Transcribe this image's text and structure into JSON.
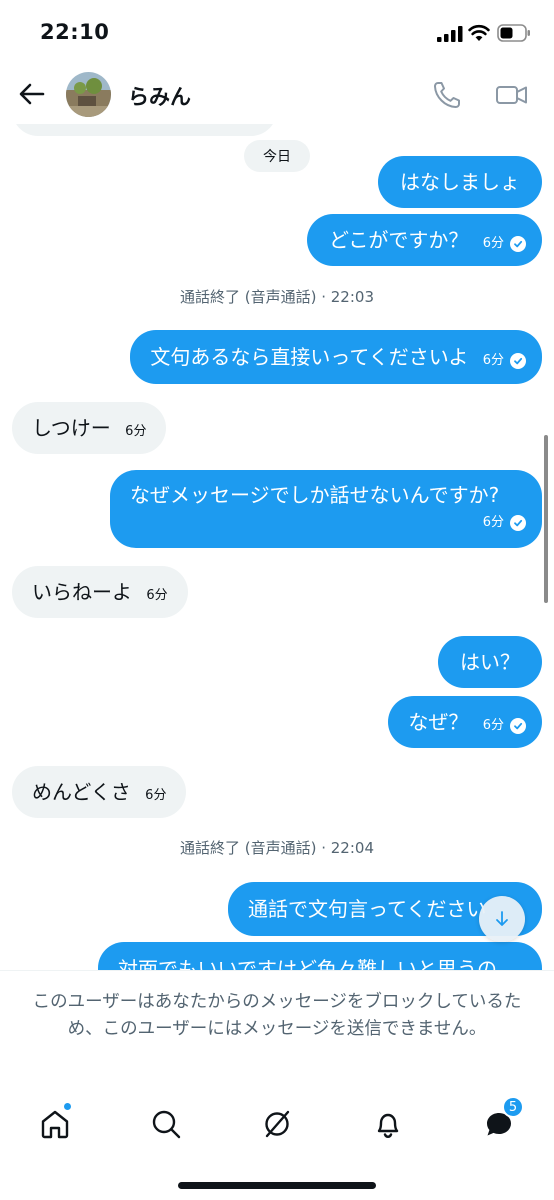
{
  "status_bar": {
    "time": "22:10"
  },
  "header": {
    "contact_name": "らみん"
  },
  "chat": {
    "day_label": "今日",
    "call_ended_1": "通話終了 (音声通話) · 22:03",
    "call_ended_2": "通話終了 (音声通話) · 22:04",
    "messages": [
      {
        "text": "はなしましょ",
        "time": ""
      },
      {
        "text": "どこがですか？",
        "time": "6分"
      },
      {
        "text": "文句あるなら直接いってくださいよ",
        "time": "6分"
      },
      {
        "text": "しつけー",
        "time": "6分"
      },
      {
        "text": "なぜメッセージでしか話せないんですか?",
        "time": "6分"
      },
      {
        "text": "いらねーよ",
        "time": "6分"
      },
      {
        "text": "はい？",
        "time": ""
      },
      {
        "text": "なぜ？",
        "time": "6分"
      },
      {
        "text": "めんどくさ",
        "time": "6分"
      },
      {
        "text": "通話で文句言ってください",
        "time": ""
      },
      {
        "text": "対面でもいいですけど色々難しいと思うの",
        "time": ""
      }
    ]
  },
  "blocked_notice": "このユーザーはあなたからのメッセージをブロックしているため、このユーザーにはメッセージを送信できません。",
  "bottom_nav": {
    "messages_badge": "5"
  },
  "colors": {
    "accent": "#1d9bf0",
    "received_bubble": "#eff3f4",
    "secondary_text": "#536471"
  },
  "icons": [
    "back-arrow-icon",
    "phone-icon",
    "video-icon",
    "chevron-down-icon",
    "home-icon",
    "search-icon",
    "grok-icon",
    "bell-icon",
    "messages-icon",
    "check-icon"
  ]
}
